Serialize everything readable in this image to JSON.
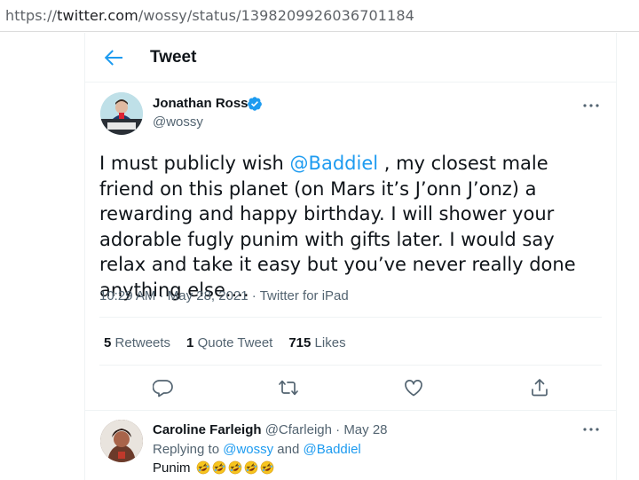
{
  "browser": {
    "url_scheme": "https://",
    "url_host": "twitter.com",
    "url_path": "/wossy/status/1398209926036701184"
  },
  "header": {
    "title": "Tweet"
  },
  "tweet": {
    "author_name": "Jonathan Ross",
    "author_handle": "@wossy",
    "text_part1": "I must publicly wish ",
    "text_mention": "@Baddiel",
    "text_part2": " , my closest male friend on this planet (on Mars it’s J’onn J’onz) a rewarding and happy birthday. I will shower your adorable fugly punim with gifts later. I would say relax and take it easy but you’ve never really done anything else....",
    "time": "10:29 AM",
    "date": "May 28, 2021",
    "separator": " · ",
    "source": "Twitter for iPad",
    "stats": {
      "retweets_count": "5",
      "retweets_label": "Retweets",
      "quotes_count": "1",
      "quotes_label": "Quote Tweet",
      "likes_count": "715",
      "likes_label": "Likes"
    },
    "icons": [
      "reply-icon",
      "retweet-icon",
      "like-icon",
      "share-icon",
      "more-icon",
      "verified-badge-icon",
      "back-arrow-icon"
    ]
  },
  "reply": {
    "author_name": "Caroline Farleigh",
    "author_handle": "@Cfarleigh",
    "separator": " · ",
    "date": "May 28",
    "replying_prefix": "Replying to ",
    "replying_to_1": "@wossy",
    "replying_and": " and ",
    "replying_to_2": "@Baddiel",
    "text": "Punim",
    "emoji_name": "rolling-on-the-floor-laughing",
    "emoji_count": 5
  },
  "colors": {
    "accent": "#1d9bf0",
    "text_primary": "#0f1419",
    "text_secondary": "#536471",
    "border": "#eff3f4"
  }
}
